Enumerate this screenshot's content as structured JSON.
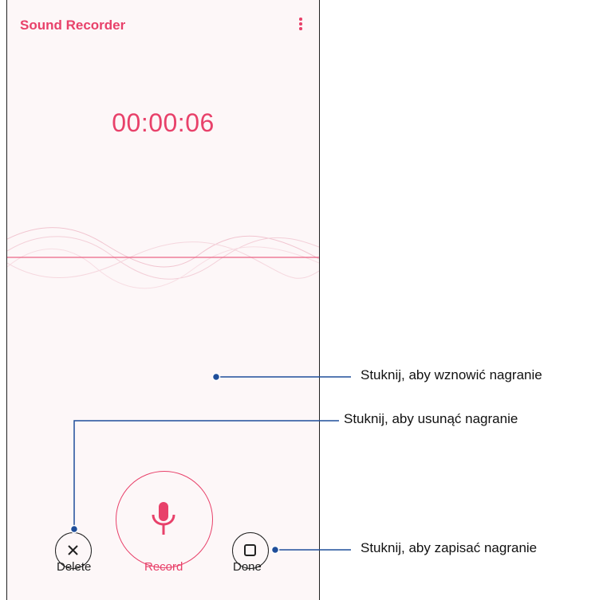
{
  "app": {
    "title": "Sound Recorder"
  },
  "timer": {
    "value": "00:00:06"
  },
  "controls": {
    "delete_label": "Delete",
    "record_label": "Record",
    "done_label": "Done"
  },
  "callouts": {
    "delete": "Stuknij, aby usunąć nagranie",
    "record": "Stuknij, aby wznowić nagranie",
    "done": "Stuknij, aby zapisać nagranie"
  },
  "icons": {
    "menu": "more-vertical-icon",
    "delete": "close-icon",
    "record": "microphone-icon",
    "done": "stop-square-icon"
  },
  "colors": {
    "accent": "#e8416a",
    "callout_line": "#1f4e9a"
  }
}
